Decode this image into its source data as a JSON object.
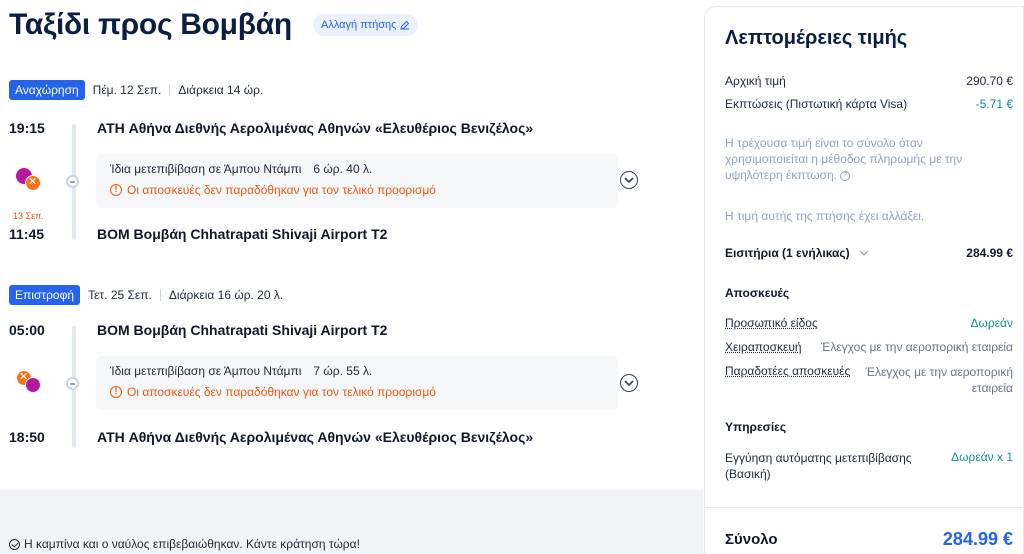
{
  "trip": {
    "title": "Ταξίδι προς Βομβάη",
    "change_flight": "Αλλαγή πτήσης"
  },
  "outbound": {
    "badge": "Αναχώρηση",
    "date": "Πέμ. 12 Σεπ.",
    "duration": "Διάρκεια 14 ώρ.",
    "dep_time": "19:15",
    "dep_airport": "ATH Αθήνα Διεθνής Αερολιμένας Αθηνών «Ελευθέριος Βενιζέλος»",
    "layover": "Ίδια μετεπιβίβαση σε Άμπου Ντάμπι",
    "layover_duration": "6 ώρ. 40 λ.",
    "warning": "Οι αποσκευές δεν παραδόθηκαν για τον τελικό προορισμό",
    "arr_date": "13 Σεπ.",
    "arr_time": "11:45",
    "arr_airport": "BOM Βομβάη Chhatrapati Shivaji Airport T2"
  },
  "return": {
    "badge": "Επιστροφή",
    "date": "Τετ. 25 Σεπ.",
    "duration": "Διάρκεια 16 ώρ. 20 λ.",
    "dep_time": "05:00",
    "dep_airport": "BOM Βομβάη Chhatrapati Shivaji Airport T2",
    "layover": "Ίδια μετεπιβίβαση σε Άμπου Ντάμπι",
    "layover_duration": "7 ώρ. 55 λ.",
    "warning": "Οι αποσκευές δεν παραδόθηκαν για τον τελικό προορισμό",
    "arr_time": "18:50",
    "arr_airport": "ATH Αθήνα Διεθνής Αερολιμένας Αθηνών «Ελευθέριος Βενιζέλος»"
  },
  "confirmation": "Η καμπίνα και ο ναύλος επιβεβαιώθηκαν. Κάντε κράτηση τώρα!",
  "price": {
    "title": "Λεπτομέρειες τιμής",
    "original_label": "Αρχική τιμή",
    "original_value": "290.70 €",
    "discount_label": "Εκπτώσεις (Πιστωτική κάρτα Visa)",
    "discount_value": "-5.71 €",
    "note": "Η τρέχουσα τιμή είναι το σύνολο όταν χρησιμοποιείται η μέθοδος πληρωμής με την υψηλότερη έκπτωση.",
    "changed_note": "Η τιμή αυτής της πτήσης έχει αλλάξει.",
    "tickets_label": "Εισιτήρια (1 ενήλικας)",
    "tickets_value": "284.99 €",
    "baggage_head": "Αποσκευές",
    "personal_label": "Προσωπικό είδος",
    "personal_value": "Δωρεάν",
    "carryon_label": "Χειραποσκευή",
    "carryon_value": "Έλεγχος με την αεροπορική εταιρεία",
    "checked_label": "Παραδοτέες αποσκευές",
    "checked_value": "Έλεγχος με την αεροπορική εταιρεία",
    "services_head": "Υπηρεσίες",
    "checkin_label": "Εγγύηση αυτόματης μετεπιβίβασης (Βασική)",
    "checkin_value": "Δωρεάν x 1",
    "total_label": "Σύνολο",
    "total_value": "284.99 €"
  },
  "colors": {
    "accent": "#2563eb",
    "warning": "#ea580c",
    "positive": "#0d9488"
  }
}
